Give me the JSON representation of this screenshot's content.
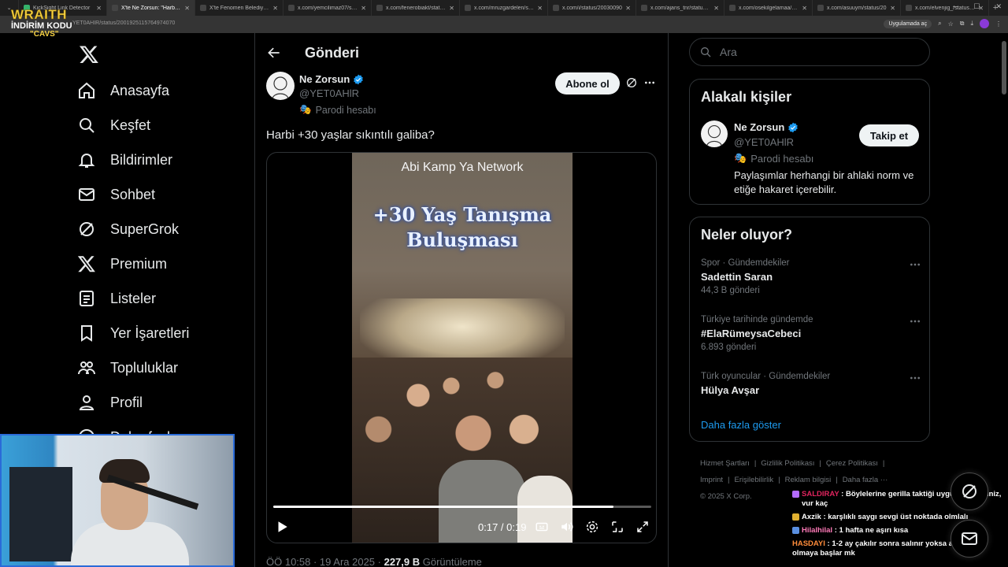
{
  "browser": {
    "tabs": [
      {
        "title": "KickSight Link Detector",
        "active": false,
        "color": "#35b36b"
      },
      {
        "title": "X'te Ne Zorsun: \"Harbi +3",
        "active": true,
        "color": "#444444"
      },
      {
        "title": "X'te Fenomen Belediye Ba",
        "active": false,
        "color": "#444444"
      },
      {
        "title": "x.com/yemcilimaz07/statu",
        "active": false,
        "color": "#444444"
      },
      {
        "title": "x.com/fenerobiakt/status/",
        "active": false,
        "color": "#444444"
      },
      {
        "title": "x.com/mruzgardelen/stat",
        "active": false,
        "color": "#444444"
      },
      {
        "title": "x.com/i/status/20030090",
        "active": false,
        "color": "#444444"
      },
      {
        "title": "x.com/ajans_tnr/status/20",
        "active": false,
        "color": "#444444"
      },
      {
        "title": "x.com/osekilgelamaa/sta",
        "active": false,
        "color": "#444444"
      },
      {
        "title": "x.com/asuuym/status/20",
        "active": false,
        "color": "#444444"
      },
      {
        "title": "x.com/elvenjig_/status/20",
        "active": false,
        "color": "#444444"
      }
    ],
    "url": "YET0AHIR/status/2001925115764974070",
    "open_in_app": "Uygulamada aç",
    "overlay_logo": {
      "line1": "WRAITH",
      "line2": "İNDİRİM KODU",
      "line3": "\"CAVS\""
    }
  },
  "nav": {
    "items": [
      {
        "label": "Anasayfa",
        "icon": "home-icon"
      },
      {
        "label": "Keşfet",
        "icon": "search-icon"
      },
      {
        "label": "Bildirimler",
        "icon": "bell-icon"
      },
      {
        "label": "Sohbet",
        "icon": "mail-icon"
      },
      {
        "label": "SuperGrok",
        "icon": "grok-icon"
      },
      {
        "label": "Premium",
        "icon": "x-icon"
      },
      {
        "label": "Listeler",
        "icon": "list-icon"
      },
      {
        "label": "Yer İşaretleri",
        "icon": "bookmark-icon"
      },
      {
        "label": "Topluluklar",
        "icon": "communities-icon"
      },
      {
        "label": "Profil",
        "icon": "profile-icon"
      },
      {
        "label": "Daha fazla",
        "icon": "more-circle-icon"
      }
    ]
  },
  "main": {
    "header_title": "Gönderi",
    "post": {
      "author_name": "Ne Zorsun",
      "author_handle": "@YET0AHlR",
      "parody_label": "Parodi hesabı",
      "follow_label": "Abone ol",
      "text": "Harbi +30 yaşlar sıkıntılı galiba?",
      "video": {
        "overlay_top": "Abi Kamp Ya Network",
        "overlay_title_1": "+30 Yaş Tanışma",
        "overlay_title_2": "Buluşması",
        "time": "0:17 / 0:19",
        "progress": 0.9
      },
      "meta_time": "ÖÖ 10:58 · 19 Ara 2025 · ",
      "views": "227,9 B",
      "views_label": " Görüntüleme"
    }
  },
  "sidebar": {
    "search_placeholder": "Ara",
    "related": {
      "title": "Alakalı kişiler",
      "name": "Ne Zorsun",
      "handle": "@YET0AHlR",
      "parody_label": "Parodi hesabı",
      "bio": "Paylaşımlar herhangi bir ahlaki norm ve etiğe hakaret içerebilir.",
      "follow_label": "Takip et"
    },
    "trends": {
      "title": "Neler oluyor?",
      "items": [
        {
          "context": "Spor · Gündemdekiler",
          "name": "Sadettin Saran",
          "count": "44,3 B gönderi"
        },
        {
          "context": "Türkiye tarihinde gündemde",
          "name": "#ElaRümeysaCebeci",
          "count": "6.893 gönderi"
        },
        {
          "context": "Türk oyuncular · Gündemdekiler",
          "name": "Hülya Avşar",
          "count": ""
        }
      ],
      "show_more": "Daha fazla göster"
    },
    "footer": {
      "links": [
        "Hizmet Şartları",
        "|",
        "Gizlilik Politikası",
        "|",
        "Çerez Politikası",
        "|",
        "Imprint",
        "|",
        "Erişilebilirlik",
        "|",
        "Reklam bilgisi",
        "|",
        "Daha fazla ···"
      ],
      "copyright": "© 2025 X Corp."
    }
  },
  "chat": [
    {
      "user": "SALDIRAY",
      "color": "#e0245e",
      "badge": "#b36bff",
      "msg": " : Böylelerine gerilla taktiği uygulayabilirsiniz, vur kaç"
    },
    {
      "user": "Axzik",
      "color": "#ffffff",
      "badge": "#e0b030",
      "msg": " : karşlıklı saygı sevgi üst noktada olmlalı"
    },
    {
      "user": "Hilalhilal",
      "color": "#ff7ab8",
      "badge": "#5a8fe0",
      "msg": " : 1 hafta ne aşırı kısa"
    },
    {
      "user": "HASDAYI",
      "color": "#ff8c3a",
      "badge": "",
      "msg": " : 1-2 ay çakılır sonra salınır yoksa aşk meşk olmaya başlar mk"
    }
  ],
  "colors": {
    "accent": "#1d9bf0",
    "background": "#000000",
    "border": "#2f3336",
    "muted": "#71767b"
  }
}
